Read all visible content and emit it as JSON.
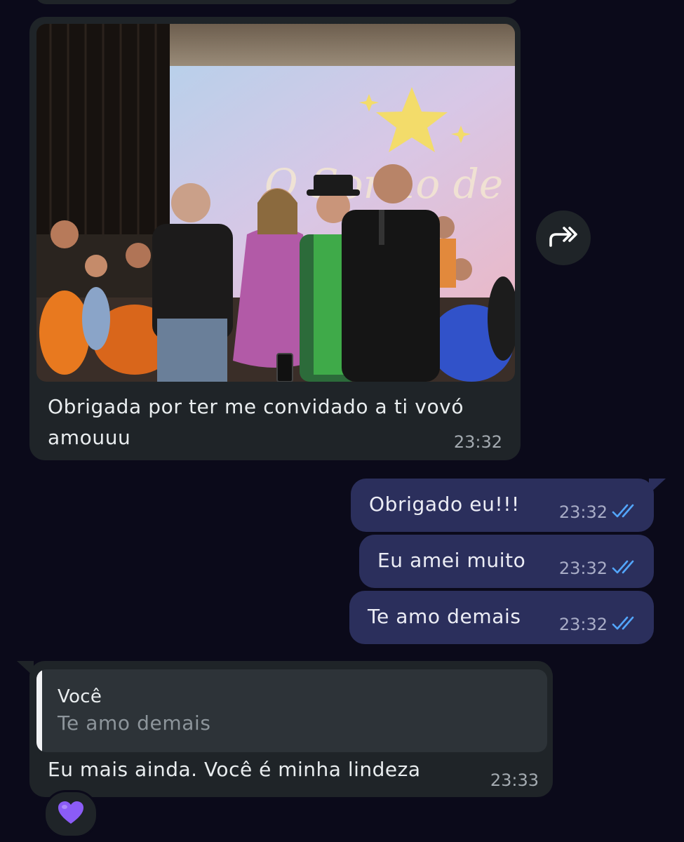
{
  "messages": {
    "incoming_photo": {
      "caption": "Obrigada por ter me convidado a ti vovó amouuu",
      "time": "23:32",
      "photo_sign_text": "O Sonho de"
    },
    "outgoing": [
      {
        "text": "Obrigado eu!!!",
        "time": "23:32",
        "status": "read"
      },
      {
        "text": "Eu amei muito",
        "time": "23:32",
        "status": "read"
      },
      {
        "text": "Te amo demais",
        "time": "23:32",
        "status": "read"
      }
    ],
    "incoming_reply": {
      "quoted_author": "Você",
      "quoted_text": "Te amo demais",
      "text": "Eu mais ainda. Você é minha lindeza",
      "time": "23:33",
      "reaction": "💜"
    }
  },
  "icons": {
    "forward": "forward-icon",
    "read_receipt": "double-check-icon",
    "reaction": "purple-heart-icon"
  },
  "colors": {
    "background": "#0b0a1a",
    "incoming_bubble": "#1f2428",
    "outgoing_bubble": "#2b2f5c",
    "read_check": "#53a6fd",
    "reaction_heart": "#8b5cf6"
  }
}
